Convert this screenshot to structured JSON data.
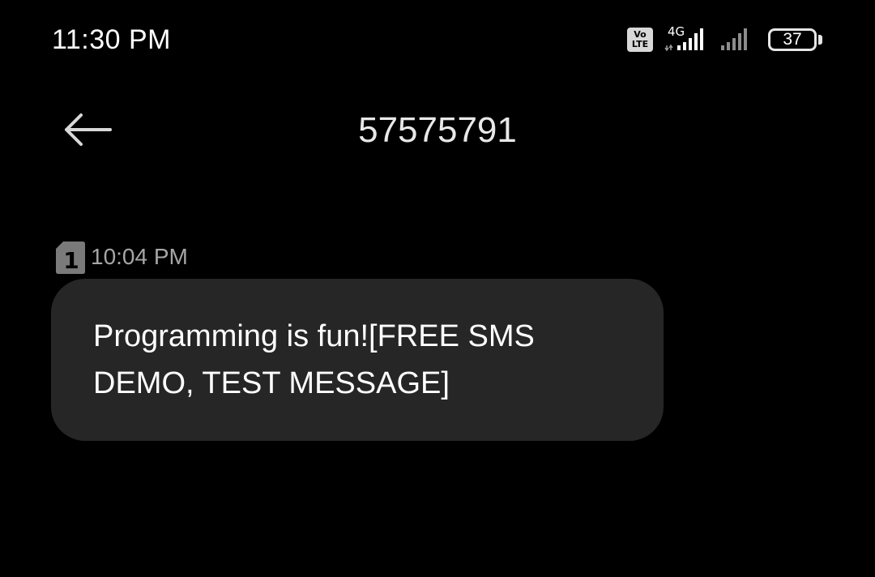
{
  "status_bar": {
    "time": "11:30 PM",
    "volte_label_top": "Vo",
    "volte_label_bottom": "LTE",
    "network_type": "4G",
    "battery_level": "37",
    "signal_sim1_bars": 5,
    "signal_sim2_bars": 5,
    "icons": [
      "volte-icon",
      "signal-icon",
      "signal-icon",
      "battery-icon"
    ]
  },
  "header": {
    "back_icon": "arrow-left-icon",
    "title": "57575791"
  },
  "messages": [
    {
      "sim": "1",
      "time": "10:04 PM",
      "text": "Programming is fun![FREE SMS DEMO, TEST MESSAGE]"
    }
  ],
  "colors": {
    "background": "#000000",
    "bubble": "#262626",
    "timestamp": "#a6a6a6"
  }
}
